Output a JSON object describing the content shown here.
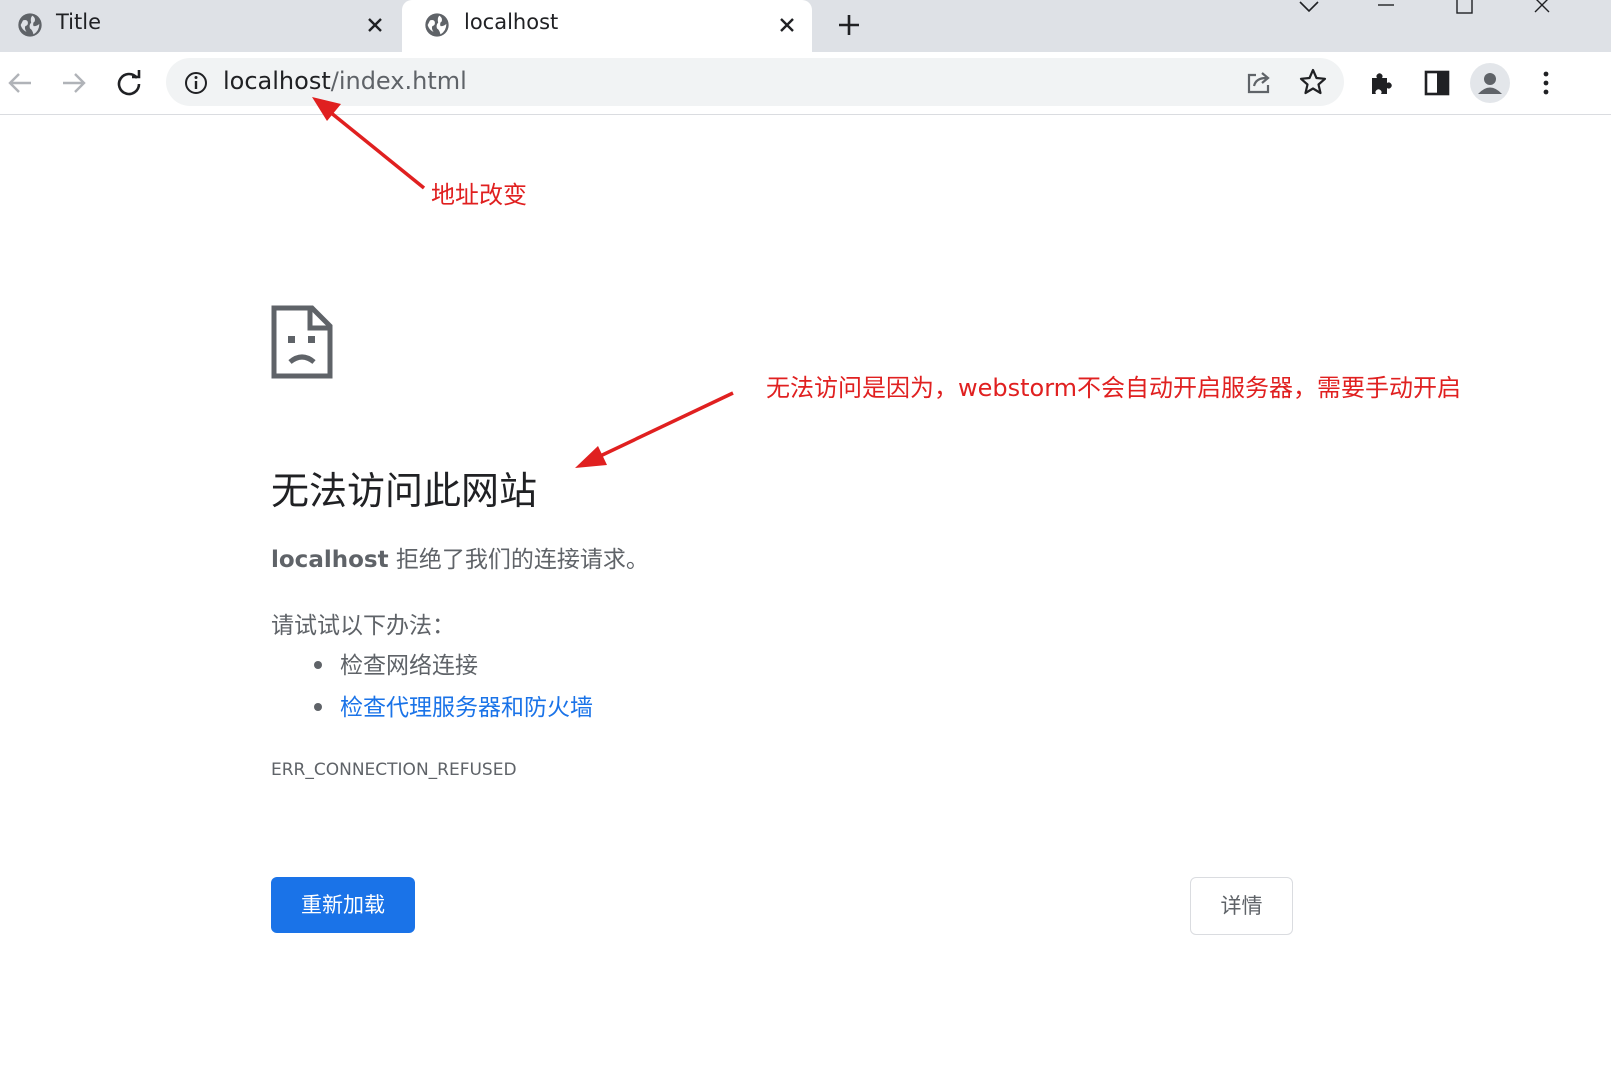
{
  "tabs": [
    {
      "title": "Title",
      "icon": "globe-icon"
    },
    {
      "title": "localhost",
      "icon": "globe-icon"
    }
  ],
  "toolbar": {
    "url_host": "localhost",
    "url_path": "/index.html"
  },
  "error": {
    "headline": "无法访问此网站",
    "refused_host": "localhost",
    "refused_text": " 拒绝了我们的连接请求。",
    "try_text": "请试试以下办法：",
    "suggestions": [
      "检查网络连接",
      "检查代理服务器和防火墙"
    ],
    "code": "ERR_CONNECTION_REFUSED",
    "reload_label": "重新加载",
    "details_label": "详情"
  },
  "annotations": {
    "address_changed": "地址改变",
    "reason": "无法访问是因为，webstorm不会自动开启服务器，需要手动开启",
    "color": "#e02020"
  },
  "colors": {
    "tabstrip": "#dee1e6",
    "link": "#1a73e8",
    "button": "#1a73e8"
  }
}
